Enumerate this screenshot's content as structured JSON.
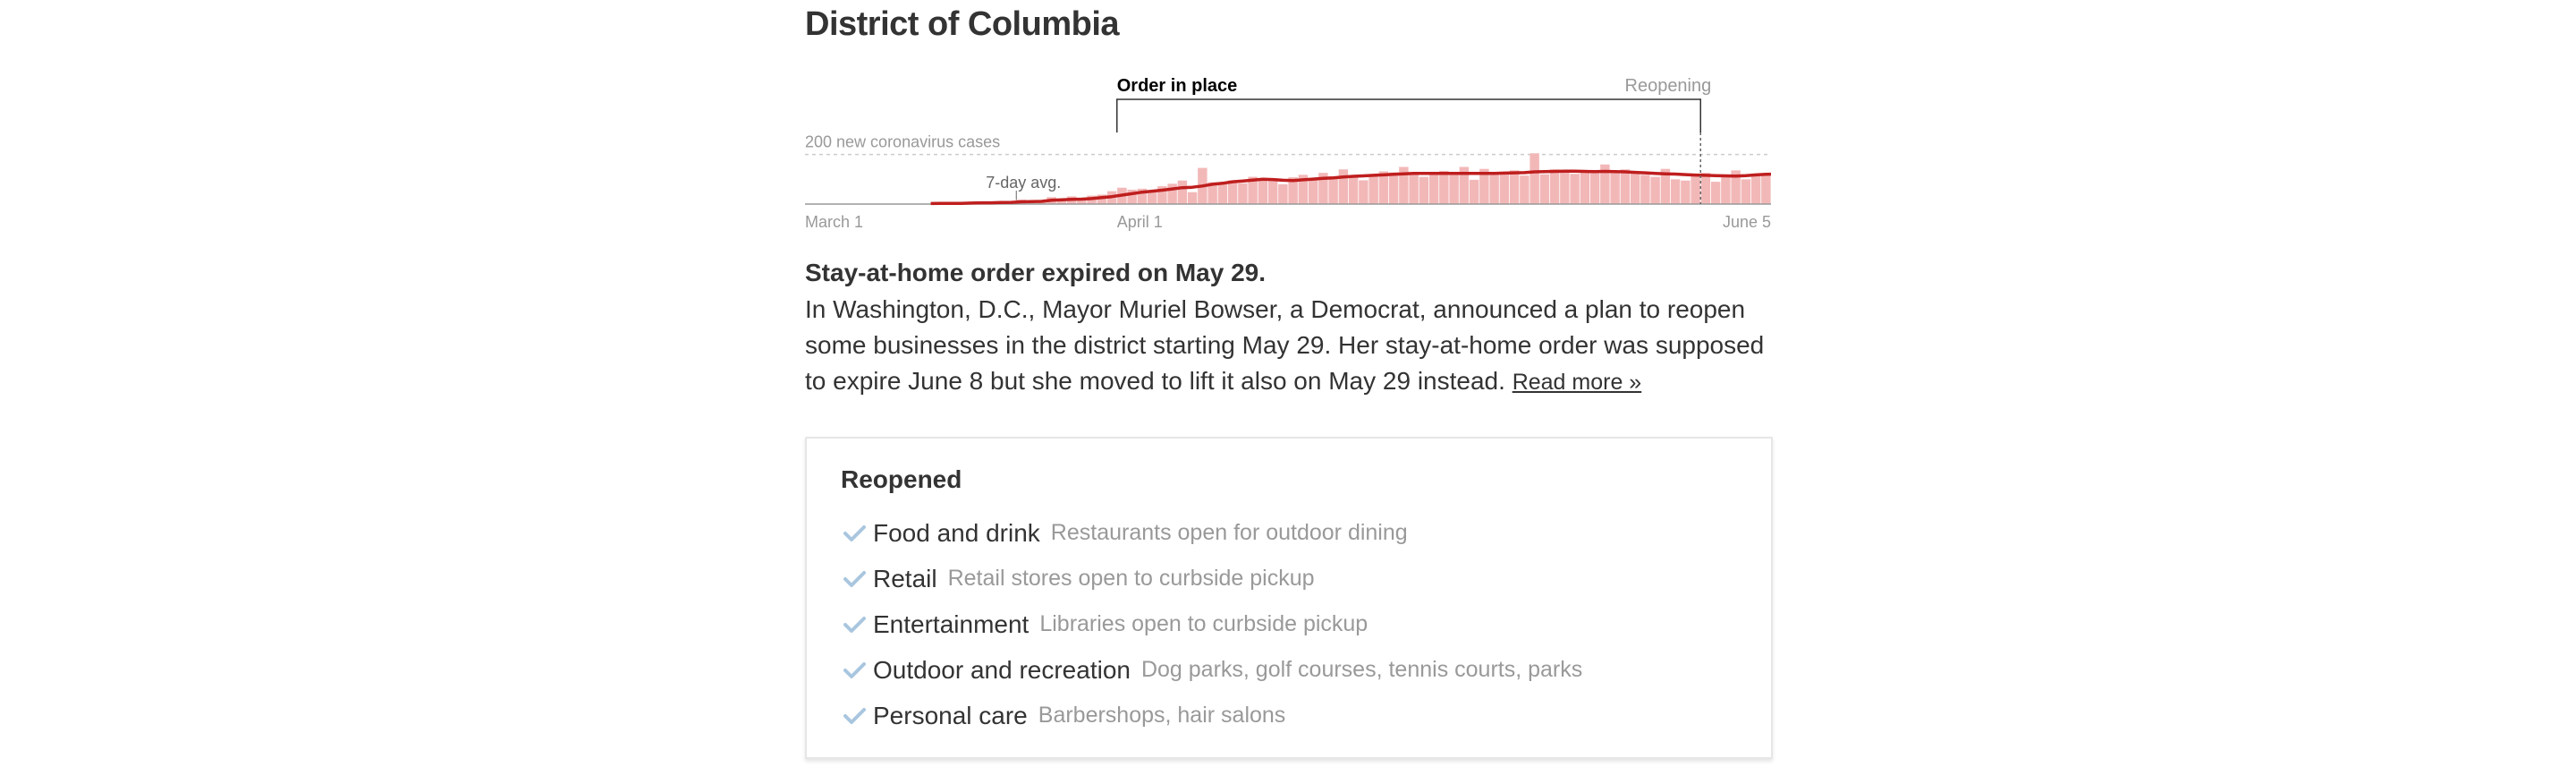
{
  "state": {
    "title": "District of Columbia"
  },
  "chart_data": {
    "type": "bar",
    "title": "",
    "xlabel": "",
    "ylabel": "",
    "x_start": "2020-03-01",
    "x_end": "2020-06-05",
    "x_ticks": [
      {
        "date": "2020-03-01",
        "label": "March 1"
      },
      {
        "date": "2020-04-01",
        "label": "April 1"
      },
      {
        "date": "2020-06-05",
        "label": "June 5"
      }
    ],
    "ylim": [
      0,
      300
    ],
    "reference_line": {
      "value": 200,
      "label": "200 new coronavirus cases"
    },
    "annotations": {
      "order_label": "Order in place",
      "order_start": "2020-04-01",
      "order_end": "2020-05-29",
      "reopening_label": "Reopening",
      "avg_label": "7-day avg."
    },
    "series": [
      {
        "name": "Daily new cases",
        "start_date": "2020-03-13",
        "values": [
          2,
          1,
          3,
          2,
          6,
          8,
          6,
          9,
          11,
          18,
          14,
          16,
          28,
          22,
          31,
          20,
          34,
          38,
          52,
          66,
          58,
          62,
          48,
          72,
          82,
          95,
          48,
          146,
          88,
          80,
          96,
          84,
          110,
          101,
          94,
          80,
          108,
          118,
          98,
          126,
          112,
          140,
          113,
          96,
          120,
          132,
          128,
          150,
          120,
          110,
          118,
          134,
          126,
          150,
          98,
          142,
          130,
          124,
          136,
          115,
          205,
          120,
          140,
          130,
          122,
          135,
          128,
          160,
          136,
          140,
          126,
          118,
          110,
          142,
          100,
          95,
          112,
          126,
          90,
          120,
          136,
          100,
          122,
          116,
          150,
          112,
          108,
          96,
          122,
          64,
          60,
          115,
          98,
          86,
          82,
          50,
          66,
          70,
          88,
          82,
          70,
          80
        ]
      },
      {
        "name": "7-day avg.",
        "start_date": "2020-03-13",
        "values": [
          2,
          3,
          3,
          3,
          4,
          5,
          5,
          6,
          7,
          9,
          10,
          11,
          15,
          17,
          19,
          20,
          22,
          26,
          30,
          36,
          42,
          48,
          52,
          56,
          61,
          66,
          68,
          73,
          80,
          84,
          90,
          93,
          97,
          100,
          99,
          96,
          95,
          98,
          101,
          104,
          106,
          109,
          112,
          114,
          116,
          118,
          120,
          122,
          124,
          124,
          124,
          124,
          124,
          124,
          124,
          124,
          124,
          125,
          126,
          127,
          130,
          131,
          132,
          133,
          133,
          132,
          131,
          132,
          131,
          130,
          128,
          126,
          124,
          122,
          121,
          119,
          117,
          116,
          115,
          114,
          113,
          115,
          118,
          120,
          121,
          120,
          117,
          114,
          110,
          104,
          98,
          94,
          92,
          89,
          85,
          80,
          77,
          74,
          70,
          68,
          66,
          64
        ]
      }
    ],
    "colors": {
      "bars": "#f2b8b8",
      "average_line": "#bf1e1e",
      "axis": "#999999",
      "label": "#999999",
      "order_label": "#000000"
    }
  },
  "summary": {
    "headline": "Stay-at-home order expired on May 29.",
    "body": "In Washington, D.C., Mayor Muriel Bowser, a Democrat, announced a plan to reopen some businesses in the district starting May 29. Her stay-at-home order was supposed to expire June 8 but she moved to lift it also on May 29 instead.",
    "read_more": "Read more »"
  },
  "reopened": {
    "title": "Reopened",
    "check_color": "#a9c6df",
    "items": [
      {
        "category": "Food and drink",
        "detail": "Restaurants open for outdoor dining",
        "icon": "check-icon"
      },
      {
        "category": "Retail",
        "detail": "Retail stores open to curbside pickup",
        "icon": "check-icon"
      },
      {
        "category": "Entertainment",
        "detail": "Libraries open to curbside pickup",
        "icon": "check-icon"
      },
      {
        "category": "Outdoor and recreation",
        "detail": "Dog parks, golf courses, tennis courts, parks",
        "icon": "check-icon"
      },
      {
        "category": "Personal care",
        "detail": "Barbershops, hair salons",
        "icon": "check-icon"
      }
    ]
  }
}
